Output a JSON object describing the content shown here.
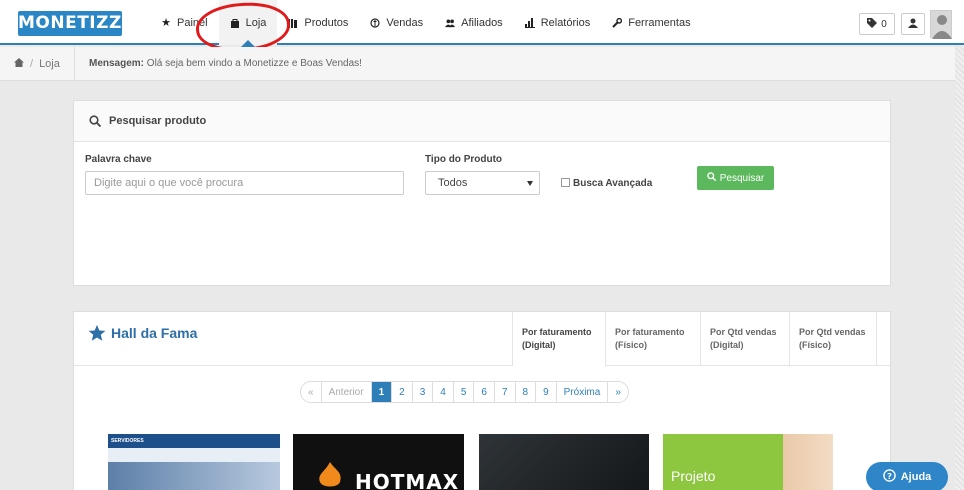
{
  "app": {
    "logo_text": "MONETIZZE"
  },
  "nav": {
    "items": [
      {
        "label": "Painel",
        "icon": "star-icon"
      },
      {
        "label": "Loja",
        "icon": "shopping-bag-icon",
        "active": true
      },
      {
        "label": "Produtos",
        "icon": "books-icon"
      },
      {
        "label": "Vendas",
        "icon": "sales-icon"
      },
      {
        "label": "Afiliados",
        "icon": "users-icon"
      },
      {
        "label": "Relatórios",
        "icon": "bar-chart-icon"
      },
      {
        "label": "Ferramentas",
        "icon": "wrench-icon"
      }
    ],
    "tag_count": "0"
  },
  "breadcrumb": {
    "current": "Loja"
  },
  "message": {
    "label": "Mensagem:",
    "text": "Olá seja bem vindo a Monetizze e Boas Vendas!"
  },
  "search_panel": {
    "title": "Pesquisar produto",
    "keyword_label": "Palavra chave",
    "keyword_placeholder": "Digite aqui o que você procura",
    "type_label": "Tipo do Produto",
    "type_value": "Todos",
    "advanced_label": "Busca Avançada",
    "search_button": "Pesquisar"
  },
  "hall": {
    "title": "Hall da Fama",
    "tabs": [
      {
        "line1": "Por faturamento",
        "line2": "(Digital)"
      },
      {
        "line1": "Por faturamento",
        "line2": "(Físico)"
      },
      {
        "line1": "Por Qtd vendas",
        "line2": "(Digital)"
      },
      {
        "line1": "Por Qtd vendas",
        "line2": "(Físico)"
      }
    ],
    "pager": {
      "first": "«",
      "prev": "Anterior",
      "pages": [
        "1",
        "2",
        "3",
        "4",
        "5",
        "6",
        "7",
        "8",
        "9"
      ],
      "next": "Próxima",
      "last": "»",
      "current": "1"
    },
    "thumbs": [
      {
        "text": "SERVIDORES"
      },
      {
        "text": "HOTMAX"
      },
      {
        "text": ""
      },
      {
        "text": "Projeto"
      }
    ]
  },
  "help": {
    "label": "Ajuda"
  },
  "colors": {
    "brand": "#2b86c5",
    "accent": "#2e7fb8",
    "success": "#5cb85c",
    "annotation": "#e01a1a"
  }
}
